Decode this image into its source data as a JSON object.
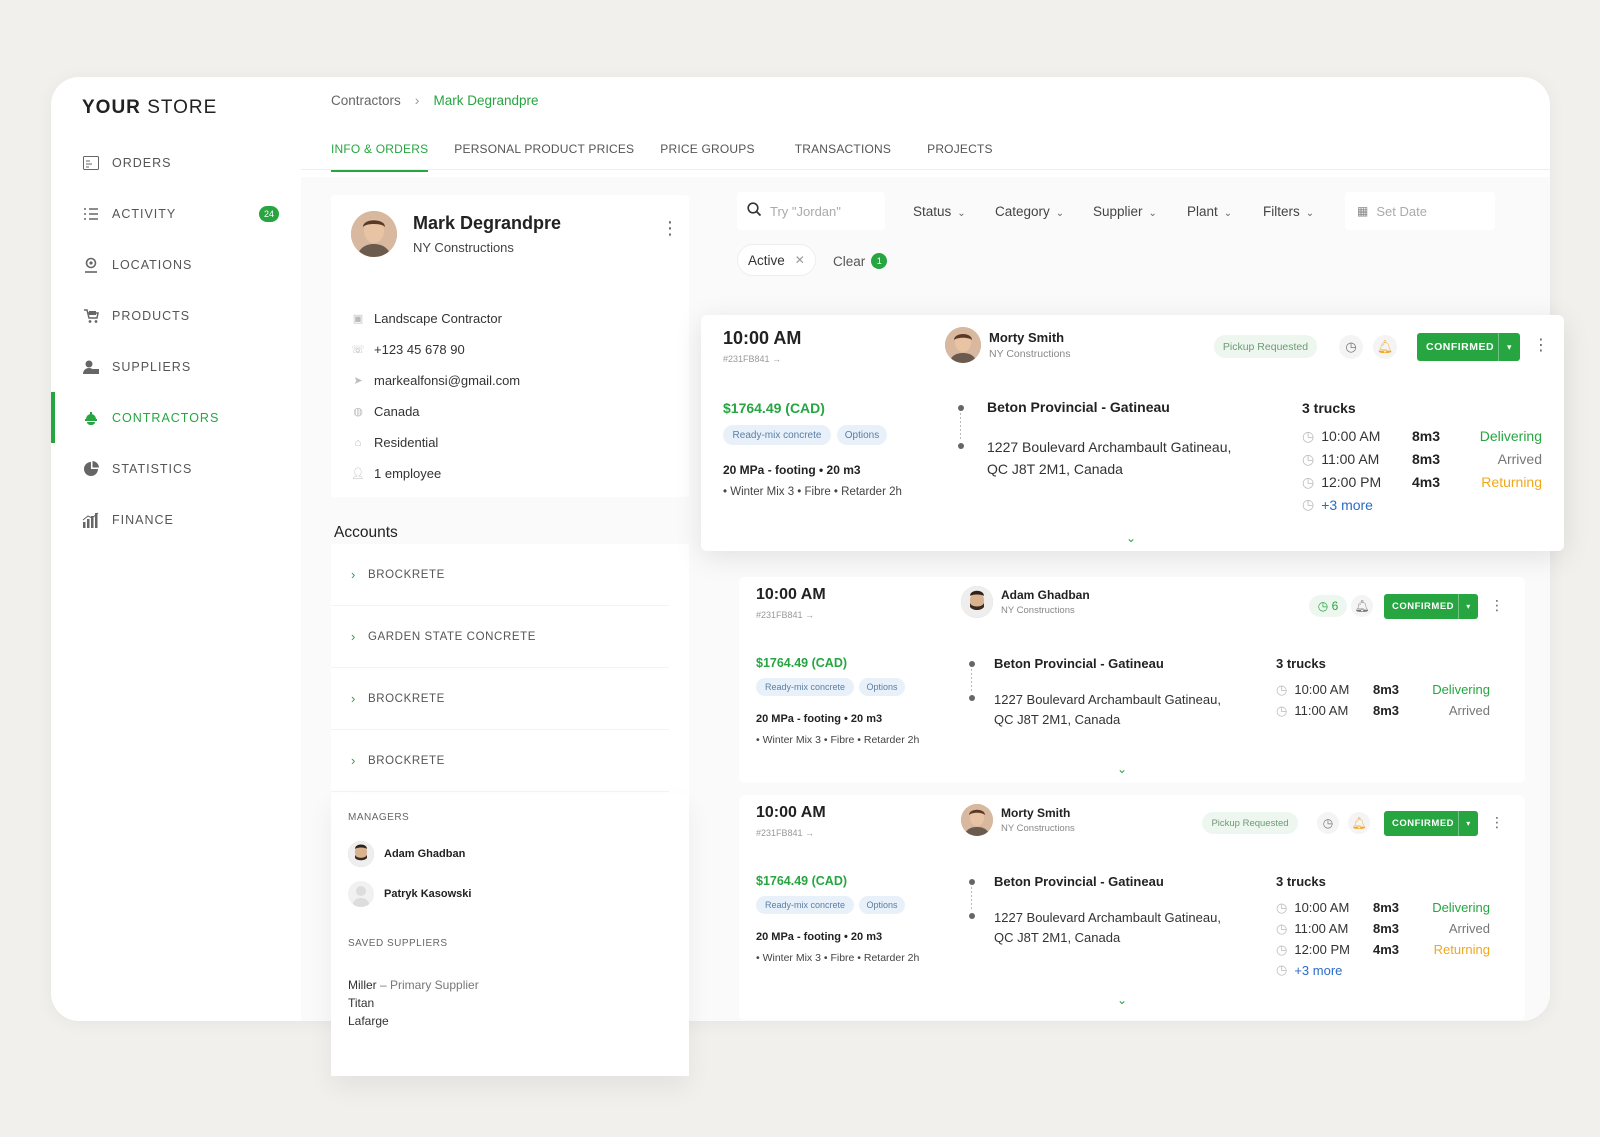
{
  "store": {
    "brand_bold": "YOUR",
    "brand_rest": "STORE"
  },
  "nav": [
    {
      "label": "ORDERS",
      "icon": "orders-icon"
    },
    {
      "label": "ACTIVITY",
      "icon": "activity-icon",
      "badge": "24"
    },
    {
      "label": "LOCATIONS",
      "icon": "locations-icon"
    },
    {
      "label": "PRODUCTS",
      "icon": "products-icon"
    },
    {
      "label": "SUPPLIERS",
      "icon": "suppliers-icon"
    },
    {
      "label": "CONTRACTORS",
      "icon": "contractors-icon",
      "active": true
    },
    {
      "label": "STATISTICS",
      "icon": "statistics-icon"
    },
    {
      "label": "FINANCE",
      "icon": "finance-icon"
    }
  ],
  "breadcrumb": {
    "parent": "Contractors",
    "current": "Mark Degrandpre"
  },
  "tabs": [
    "INFO & ORDERS",
    "PERSONAL PRODUCT PRICES",
    "PRICE GROUPS",
    "TRANSACTIONS",
    "PROJECTS"
  ],
  "profile": {
    "name": "Mark Degrandpre",
    "company": "NY Constructions",
    "info": [
      "Landscape Contractor",
      "+123 45 678 90",
      "markealfonsi@gmail.com",
      "Canada",
      "Residential",
      "1 employee"
    ]
  },
  "accounts": {
    "title": "Accounts",
    "items": [
      "BROCKRETE",
      "GARDEN STATE CONCRETE",
      "BROCKRETE",
      "BROCKRETE"
    ]
  },
  "managers": {
    "label": "MANAGERS",
    "people": [
      "Adam Ghadban",
      "Patryk Kasowski"
    ]
  },
  "saved_suppliers": {
    "label": "SAVED SUPPLIERS",
    "primary_name": "Miller",
    "primary_note": " – Primary Supplier",
    "others": [
      "Titan",
      "Lafarge"
    ]
  },
  "filters": {
    "search_placeholder": "Try \"Jordan\"",
    "dropdowns": [
      "Status",
      "Category",
      "Supplier",
      "Plant",
      "Filters"
    ],
    "date_placeholder": "Set Date",
    "active_chip": "Active",
    "clear_label": "Clear",
    "clear_count": "1"
  },
  "orders": [
    {
      "time": "10:00 AM",
      "id": "#231FB841 →",
      "person": "Morty Smith",
      "person_company": "NY Constructions",
      "pill": "Pickup Requested",
      "timer": "",
      "status": "CONFIRMED",
      "price": "$1764.49 (CAD)",
      "tags": [
        "Ready-mix concrete",
        "Options"
      ],
      "spec": "20 MPa - footing • 20 m3",
      "spec2": "• Winter Mix 3 • Fibre • Retarder 2h",
      "plant": "Beton Provincial - Gatineau",
      "address1": "1227 Boulevard Archambault Gatineau,",
      "address2": "QC J8T 2M1, Canada",
      "trucks_title": "3 trucks",
      "trucks": [
        {
          "time": "10:00 AM",
          "volume": "8m3",
          "status": "Delivering",
          "kind": "delivering"
        },
        {
          "time": "11:00 AM",
          "volume": "8m3",
          "status": "Arrived",
          "kind": "arrived"
        },
        {
          "time": "12:00 PM",
          "volume": "4m3",
          "status": "Returning",
          "kind": "returning"
        }
      ],
      "more": "+3 more"
    },
    {
      "time": "10:00 AM",
      "id": "#231FB841 →",
      "person": "Adam Ghadban",
      "person_company": "NY Constructions",
      "pill": "",
      "timer": "6",
      "status": "CONFIRMED",
      "price": "$1764.49 (CAD)",
      "tags": [
        "Ready-mix concrete",
        "Options"
      ],
      "spec": "20 MPa - footing • 20 m3",
      "spec2": "• Winter Mix 3 • Fibre • Retarder 2h",
      "plant": "Beton Provincial - Gatineau",
      "address1": "1227 Boulevard Archambault Gatineau,",
      "address2": "QC J8T 2M1, Canada",
      "trucks_title": "3 trucks",
      "trucks": [
        {
          "time": "10:00 AM",
          "volume": "8m3",
          "status": "Delivering",
          "kind": "delivering"
        },
        {
          "time": "11:00 AM",
          "volume": "8m3",
          "status": "Arrived",
          "kind": "arrived"
        }
      ],
      "more": ""
    },
    {
      "time": "10:00 AM",
      "id": "#231FB841 →",
      "person": "Morty Smith",
      "person_company": "NY Constructions",
      "pill": "Pickup Requested",
      "timer": "",
      "status": "CONFIRMED",
      "price": "$1764.49 (CAD)",
      "tags": [
        "Ready-mix concrete",
        "Options"
      ],
      "spec": "20 MPa - footing • 20 m3",
      "spec2": "• Winter Mix 3 • Fibre • Retarder 2h",
      "plant": "Beton Provincial - Gatineau",
      "address1": "1227 Boulevard Archambault Gatineau,",
      "address2": "QC J8T 2M1, Canada",
      "trucks_title": "3 trucks",
      "trucks": [
        {
          "time": "10:00 AM",
          "volume": "8m3",
          "status": "Delivering",
          "kind": "delivering"
        },
        {
          "time": "11:00 AM",
          "volume": "8m3",
          "status": "Arrived",
          "kind": "arrived"
        },
        {
          "time": "12:00 PM",
          "volume": "4m3",
          "status": "Returning",
          "kind": "returning"
        }
      ],
      "more": "+3 more"
    }
  ],
  "colors": {
    "accent": "#26a541",
    "returning": "#f0a81b",
    "link": "#2b6cc4"
  }
}
